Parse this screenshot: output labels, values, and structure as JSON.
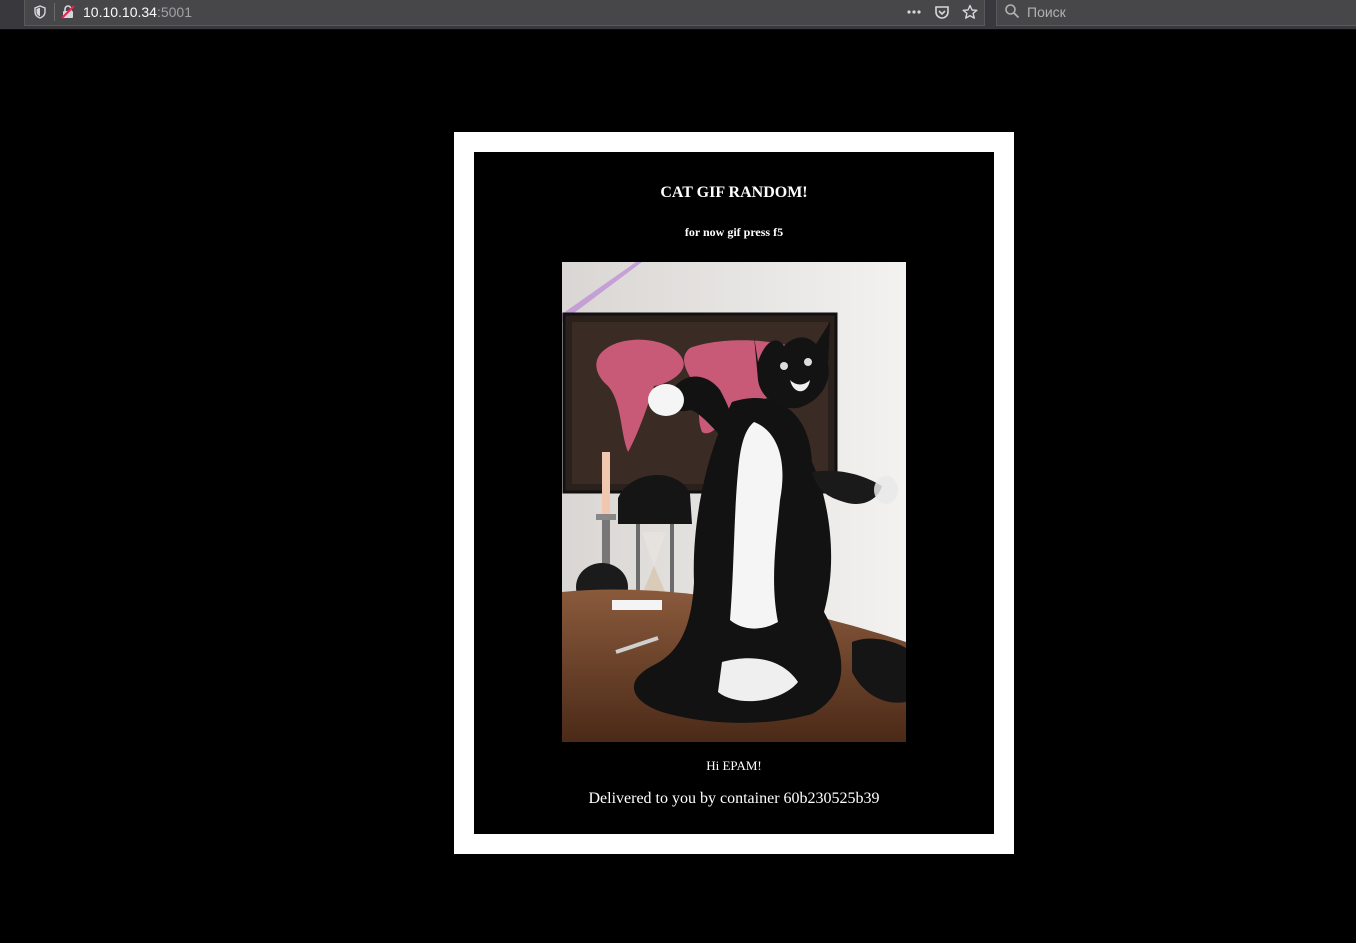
{
  "browser": {
    "url_host": "10.10.10.34",
    "url_port": ":5001",
    "search_placeholder": "Поиск",
    "icons": [
      "shield-icon",
      "insecure-lock-icon",
      "page-actions-icon",
      "pocket-icon",
      "bookmark-star-icon",
      "search-icon"
    ]
  },
  "page": {
    "title": "CAT GIF RANDOM!",
    "subtitle": "for now gif press f5",
    "image_alt": "cat gif",
    "greeting": "Hi EPAM!",
    "footer": "Delivered to you by container 60b230525b39"
  },
  "colors": {
    "page_background": "#000000",
    "frame_border": "#ffffff",
    "toolbar": "#38383d"
  }
}
